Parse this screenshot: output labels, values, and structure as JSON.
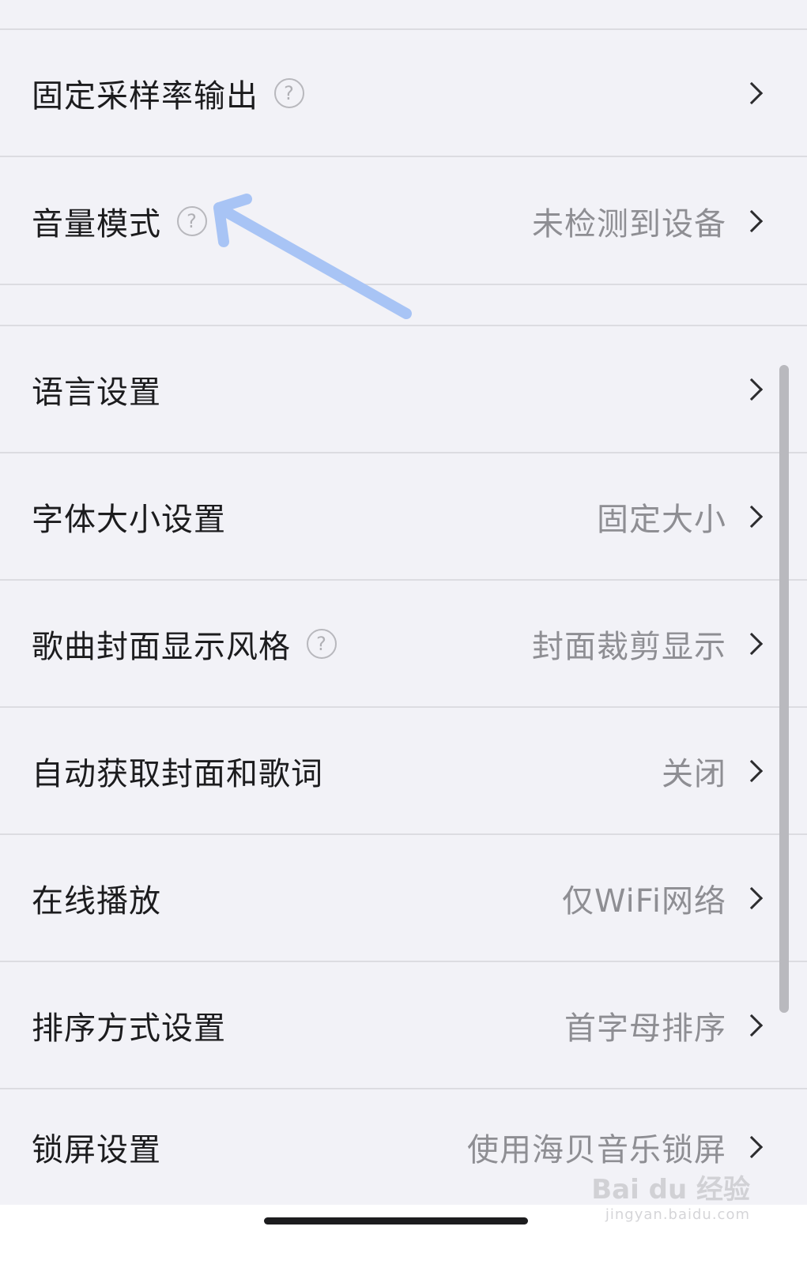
{
  "settings": {
    "rows": [
      {
        "label": "固定采样率输出",
        "value": "",
        "help": true
      },
      {
        "label": "音量模式",
        "value": "未检测到设备",
        "help": true
      },
      {
        "label": "语言设置",
        "value": "",
        "help": false
      },
      {
        "label": "字体大小设置",
        "value": "固定大小",
        "help": false
      },
      {
        "label": "歌曲封面显示风格",
        "value": "封面裁剪显示",
        "help": true
      },
      {
        "label": "自动获取封面和歌词",
        "value": "关闭",
        "help": false
      },
      {
        "label": "在线播放",
        "value": "仅WiFi网络",
        "help": false
      },
      {
        "label": "排序方式设置",
        "value": "首字母排序",
        "help": false
      },
      {
        "label": "锁屏设置",
        "value": "使用海贝音乐锁屏",
        "help": false
      }
    ],
    "help_glyph": "?"
  },
  "annotation": {
    "arrow_color": "#a8c4f5"
  },
  "watermark": {
    "brand": "Bai du 经验",
    "url": "jingyan.baidu.com"
  }
}
